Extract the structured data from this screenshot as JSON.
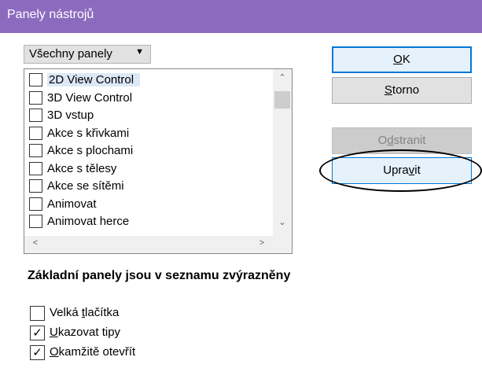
{
  "window": {
    "title": "Panely nástrojů"
  },
  "filter": {
    "selected": "Všechny panely"
  },
  "toolbars": [
    {
      "label": "2D View Control",
      "checked": false,
      "selected": true
    },
    {
      "label": "3D View Control",
      "checked": false,
      "selected": false
    },
    {
      "label": "3D vstup",
      "checked": false,
      "selected": false
    },
    {
      "label": "Akce s křivkami",
      "checked": false,
      "selected": false
    },
    {
      "label": "Akce s plochami",
      "checked": false,
      "selected": false
    },
    {
      "label": "Akce s tělesy",
      "checked": false,
      "selected": false
    },
    {
      "label": "Akce se sítěmi",
      "checked": false,
      "selected": false
    },
    {
      "label": "Animovat",
      "checked": false,
      "selected": false
    },
    {
      "label": "Animovat herce",
      "checked": false,
      "selected": false
    }
  ],
  "buttons": {
    "ok": {
      "label": "OK",
      "mnemonic": "O"
    },
    "cancel": {
      "label": "Storno",
      "mnemonic": "S"
    },
    "delete": {
      "label": "Odstranit",
      "mnemonic": "d",
      "enabled": false
    },
    "edit": {
      "label": "Upravit",
      "mnemonic": "v"
    }
  },
  "note": "Základní panely jsou v seznamu zvýrazněny",
  "options": {
    "large_buttons": {
      "label": "Velká tlačítka",
      "mnemonic": "t",
      "checked": false
    },
    "show_tips": {
      "label": "Ukazovat tipy",
      "mnemonic": "U",
      "checked": true
    },
    "open_immediately": {
      "label": "Okamžitě otevřít",
      "mnemonic": "O",
      "checked": true
    }
  },
  "colors": {
    "titlebar": "#8c6bbf",
    "accent": "#0078d7",
    "highlight": "#dce8f7"
  }
}
